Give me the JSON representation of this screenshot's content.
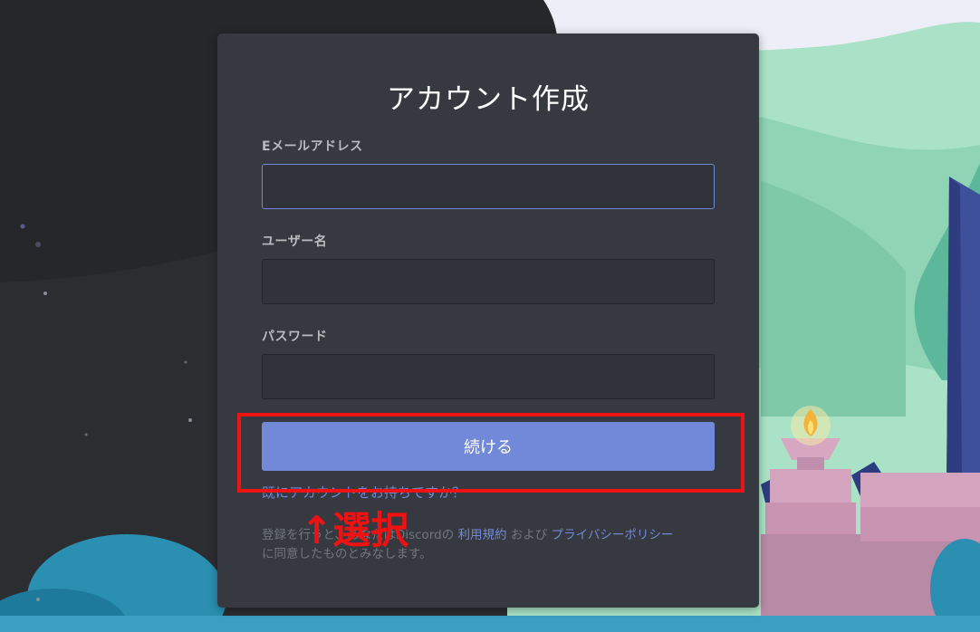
{
  "form": {
    "title": "アカウント作成",
    "email_label": "Eメールアドレス",
    "email_value": "",
    "username_label": "ユーザー名",
    "username_value": "",
    "password_label": "パスワード",
    "password_value": "",
    "continue_label": "続ける",
    "login_link": "既にアカウントをお持ちですか？",
    "terms_prefix": "登録を行うと、あなたはDiscordの",
    "terms_link": "利用規約",
    "terms_middle": "および",
    "privacy_link": "プライバシーポリシー",
    "terms_suffix": "に同意したものとみなします。"
  },
  "annotation": {
    "text": "↑選択",
    "color": "#ee1212"
  },
  "colors": {
    "accent": "#7289da",
    "card": "#36393f",
    "input_bg": "#303339"
  }
}
